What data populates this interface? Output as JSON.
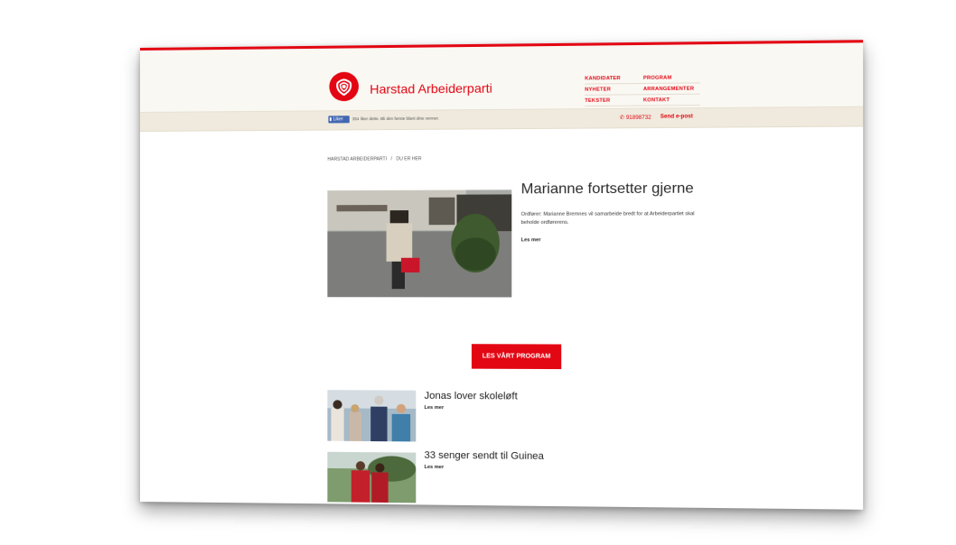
{
  "site": {
    "name": "Harstad Arbeiderparti"
  },
  "nav": {
    "col1": [
      "KANDIDATER",
      "NYHETER",
      "TEKSTER"
    ],
    "col2": [
      "PROGRAM",
      "ARRANGEMENTER",
      "KONTAKT"
    ]
  },
  "social": {
    "like_label": "Liker",
    "like_text": "354 liker dette. Bli den første blant dine venner."
  },
  "contact": {
    "phone": "91898732",
    "email_label": "Send e-post"
  },
  "breadcrumb": {
    "home": "HARSTAD ARBEIDERPARTI",
    "separator": "/",
    "current": "DU ER HER"
  },
  "feature": {
    "title": "Marianne fortsetter gjerne",
    "excerpt": "Ordfører: Marianne Bremnes vil samarbeide bredt for at Arbeiderpartiet skal beholde ordførerens.",
    "more": "Les mer"
  },
  "program_button": "LES VÅRT PROGRAM",
  "articles": [
    {
      "title": "Jonas lover skoleløft",
      "more": "Les mer"
    },
    {
      "title": "33 senger sendt til Guinea",
      "more": "Les mer"
    }
  ],
  "colors": {
    "brand": "#e30613",
    "header_bg": "#faf8f3",
    "subbar_bg": "#efeadd"
  },
  "icons": [
    "rose-logo-icon",
    "phone-icon",
    "facebook-like-icon"
  ]
}
